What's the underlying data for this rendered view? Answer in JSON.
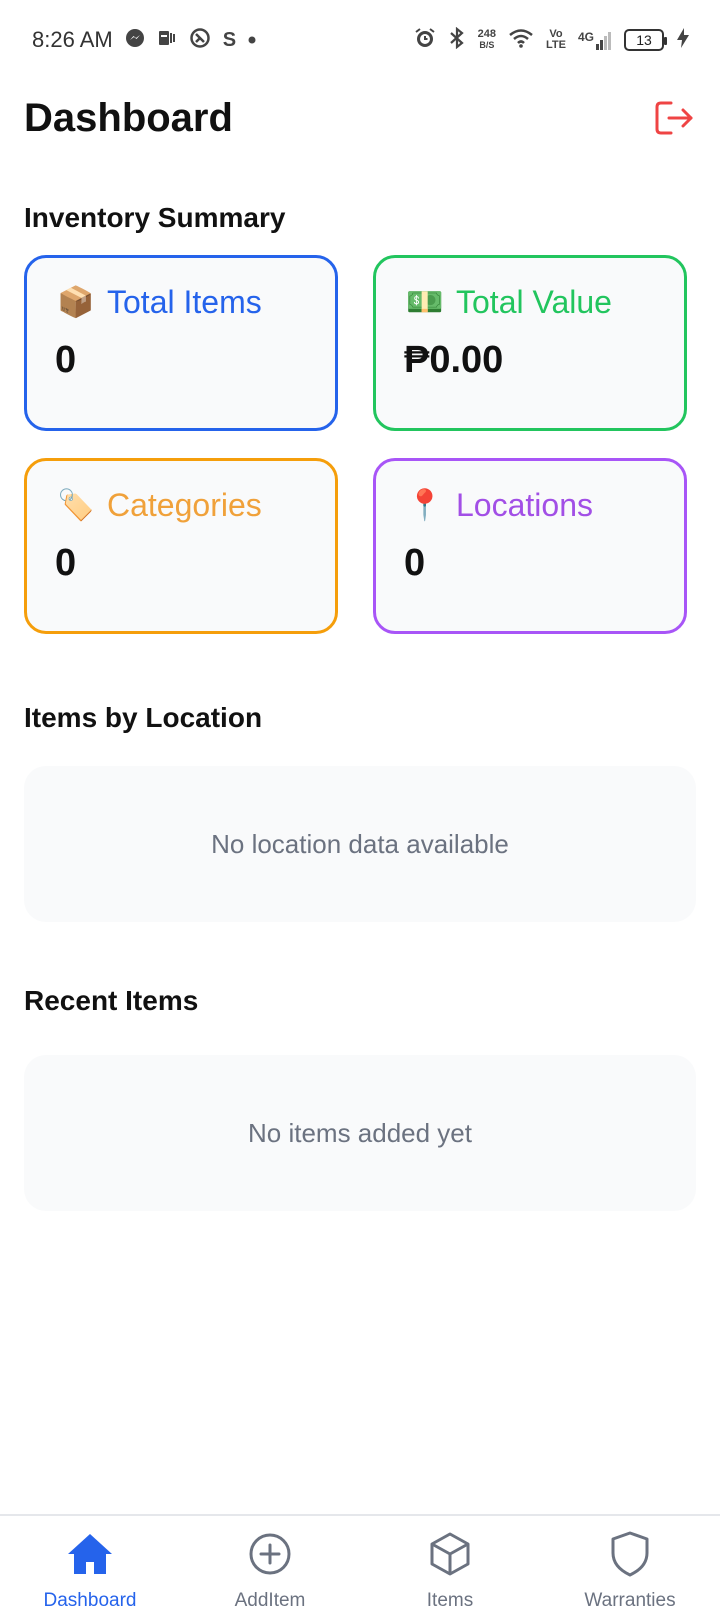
{
  "status_bar": {
    "time": "8:26 AM",
    "net_speed_value": "248",
    "net_speed_unit": "B/S",
    "volte_top": "Vo",
    "volte_bottom": "LTE",
    "network": "4G",
    "battery": "13"
  },
  "header": {
    "title": "Dashboard",
    "logout_icon": "logout-icon",
    "logout_color": "#ef4444"
  },
  "summary": {
    "title": "Inventory Summary",
    "cards": [
      {
        "icon": "📦",
        "label": "Total Items",
        "value": "0",
        "color": "#2563eb"
      },
      {
        "icon": "💵",
        "label": "Total Value",
        "value": "₱0.00",
        "color": "#22c55e"
      },
      {
        "icon": "🏷️",
        "label": "Categories",
        "value": "0",
        "color": "#f59e0b"
      },
      {
        "icon": "📍",
        "label": "Locations",
        "value": "0",
        "color": "#a855f7"
      }
    ]
  },
  "items_by_location": {
    "title": "Items by Location",
    "empty_text": "No location data available"
  },
  "recent_items": {
    "title": "Recent Items",
    "empty_text": "No items added yet"
  },
  "bottom_nav": {
    "active_color": "#2563eb",
    "items": [
      {
        "label": "Dashboard",
        "icon": "home-icon"
      },
      {
        "label": "AddItem",
        "icon": "plus-circle-icon"
      },
      {
        "label": "Items",
        "icon": "cube-icon"
      },
      {
        "label": "Warranties",
        "icon": "shield-icon"
      }
    ]
  }
}
